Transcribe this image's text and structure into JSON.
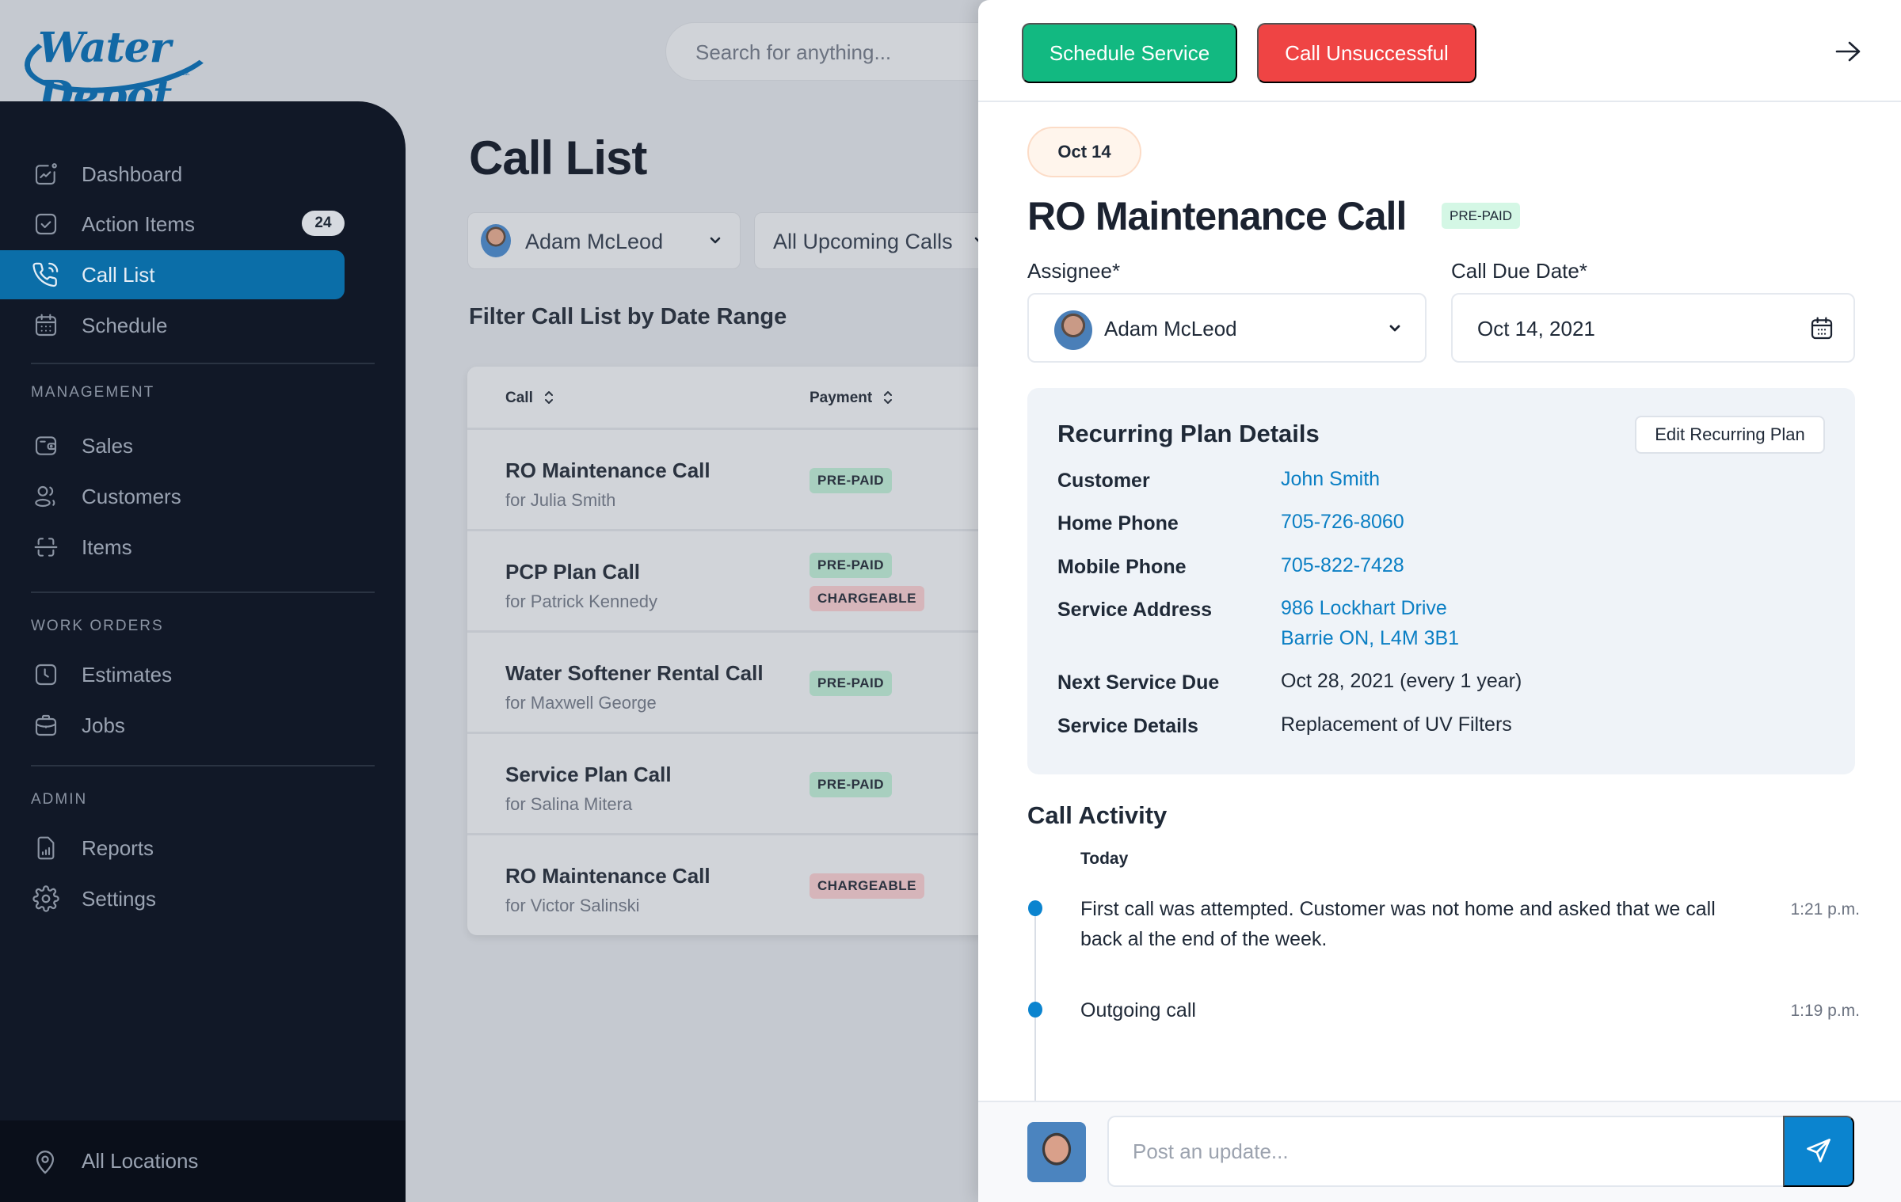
{
  "brand": {
    "name": "Water Depot"
  },
  "search": {
    "placeholder": "Search for anything..."
  },
  "sidebar": {
    "items": [
      {
        "label": "Dashboard",
        "icon": "chart-icon"
      },
      {
        "label": "Action Items",
        "icon": "checkbox-icon",
        "badge": "24"
      },
      {
        "label": "Call List",
        "icon": "phone-icon",
        "active": true
      },
      {
        "label": "Schedule",
        "icon": "calendar-icon"
      }
    ],
    "sections": [
      {
        "title": "MANAGEMENT",
        "items": [
          {
            "label": "Sales",
            "icon": "wallet-icon"
          },
          {
            "label": "Customers",
            "icon": "users-icon"
          },
          {
            "label": "Items",
            "icon": "scan-icon"
          }
        ]
      },
      {
        "title": "WORK ORDERS",
        "items": [
          {
            "label": "Estimates",
            "icon": "clock-icon"
          },
          {
            "label": "Jobs",
            "icon": "briefcase-icon"
          }
        ]
      },
      {
        "title": "ADMIN",
        "items": [
          {
            "label": "Reports",
            "icon": "report-icon"
          },
          {
            "label": "Settings",
            "icon": "gear-icon"
          }
        ]
      }
    ],
    "location": {
      "label": "All Locations",
      "icon": "location-pin-icon"
    }
  },
  "main": {
    "title": "Call List",
    "assignee_filter": "Adam McLeod",
    "calls_filter": "All Upcoming Calls",
    "date_range_heading": "Filter Call List by Date Range",
    "table": {
      "columns": [
        "Call",
        "Payment"
      ],
      "rows": [
        {
          "title": "RO Maintenance Call",
          "subtitle": "for Julia Smith",
          "tags": [
            "PRE-PAID"
          ]
        },
        {
          "title": "PCP Plan Call",
          "subtitle": "for Patrick Kennedy",
          "tags": [
            "PRE-PAID",
            "CHARGEABLE"
          ]
        },
        {
          "title": "Water Softener Rental Call",
          "subtitle": "for Maxwell George",
          "tags": [
            "PRE-PAID"
          ]
        },
        {
          "title": "Service Plan Call",
          "subtitle": "for Salina Mitera",
          "tags": [
            "PRE-PAID"
          ]
        },
        {
          "title": "RO Maintenance Call",
          "subtitle": "for Victor Salinski",
          "tags": [
            "CHARGEABLE"
          ]
        }
      ]
    }
  },
  "panel": {
    "schedule_button": "Schedule Service",
    "unsuccessful_button": "Call Unsuccessful",
    "date_pill": "Oct 14",
    "call_title": "RO Maintenance Call",
    "call_tag": "PRE-PAID",
    "assignee_label": "Assignee*",
    "assignee_value": "Adam McLeod",
    "due_label": "Call Due Date*",
    "due_value": "Oct 14, 2021",
    "plan": {
      "title": "Recurring Plan Details",
      "edit_button": "Edit Recurring Plan",
      "customer_label": "Customer",
      "customer_value": "John Smith",
      "home_label": "Home Phone",
      "home_value": "705-726-8060",
      "mobile_label": "Mobile Phone",
      "mobile_value": "705-822-7428",
      "address_label": "Service Address",
      "address_line1": "986 Lockhart Drive",
      "address_line2": "Barrie ON, L4M 3B1",
      "next_label": "Next Service Due",
      "next_value": "Oct 28, 2021 (every 1 year)",
      "details_label": "Service Details",
      "details_value": "Replacement of UV Filters"
    },
    "activity": {
      "title": "Call Activity",
      "group": "Today",
      "entries": [
        {
          "text": "First call was attempted.  Customer was not home and asked that we call back al the end of the week.",
          "time": "1:21 p.m."
        },
        {
          "text": "Outgoing call",
          "time": "1:19 p.m."
        }
      ]
    },
    "post_placeholder": "Post an update..."
  },
  "colors": {
    "accent": "#0b6ea8",
    "success": "#12b981",
    "danger": "#ef4444",
    "link": "#0b7fc4"
  }
}
